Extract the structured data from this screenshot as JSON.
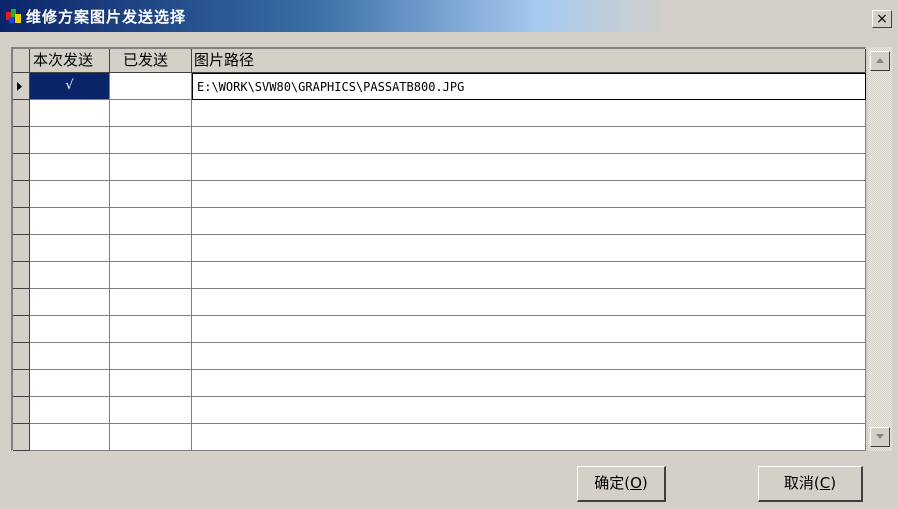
{
  "window": {
    "title": "维修方案图片发送选择",
    "close_label": "×"
  },
  "grid": {
    "columns": [
      "本次发送",
      "已发送",
      "图片路径"
    ],
    "rows": [
      {
        "current": "√",
        "sent": "",
        "path": "E:\\WORK\\SVW80\\GRAPHICS\\PASSATB800.JPG"
      },
      {
        "current": "",
        "sent": "",
        "path": ""
      },
      {
        "current": "",
        "sent": "",
        "path": ""
      },
      {
        "current": "",
        "sent": "",
        "path": ""
      },
      {
        "current": "",
        "sent": "",
        "path": ""
      },
      {
        "current": "",
        "sent": "",
        "path": ""
      },
      {
        "current": "",
        "sent": "",
        "path": ""
      },
      {
        "current": "",
        "sent": "",
        "path": ""
      },
      {
        "current": "",
        "sent": "",
        "path": ""
      },
      {
        "current": "",
        "sent": "",
        "path": ""
      },
      {
        "current": "",
        "sent": "",
        "path": ""
      },
      {
        "current": "",
        "sent": "",
        "path": ""
      },
      {
        "current": "",
        "sent": "",
        "path": ""
      },
      {
        "current": "",
        "sent": "",
        "path": ""
      }
    ]
  },
  "buttons": {
    "ok": {
      "label": "确定",
      "mnemonic": "O"
    },
    "cancel": {
      "label": "取消",
      "mnemonic": "C"
    }
  },
  "colors": {
    "selection": "#0a246a",
    "face": "#d4d0c8"
  }
}
